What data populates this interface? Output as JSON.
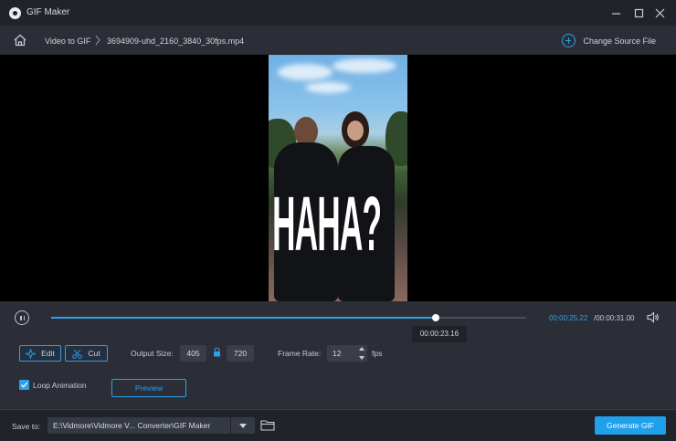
{
  "window": {
    "title": "GIF Maker",
    "minimize_icon": "minimize-icon",
    "maximize_icon": "maximize-icon",
    "close_icon": "close-icon"
  },
  "breadcrumb": {
    "home_icon": "home-icon",
    "items": [
      "Video to GIF",
      "3694909-uhd_2160_3840_30fps.mp4"
    ],
    "change_source_label": "Change Source File"
  },
  "video": {
    "overlay_text": "HAHA?"
  },
  "playback": {
    "current_time": "00:00:25.22",
    "total_time": "/00:00:31.00",
    "progress": 0.81,
    "hover_time": "00:00:23.16"
  },
  "options": {
    "edit_label": "Edit",
    "cut_label": "Cut",
    "output_size_label": "Output Size:",
    "width": "405",
    "height": "720",
    "frame_rate_label": "Frame Rate:",
    "frame_rate": "12",
    "fps_label": "fps",
    "loop_label": "Loop Animation",
    "loop_checked": true,
    "preview_label": "Preview"
  },
  "footer": {
    "save_to_label": "Save to:",
    "save_path": "E:\\Vidmore\\Vidmore V... Converter\\GIF Maker",
    "generate_label": "Generate GIF"
  },
  "colors": {
    "accent": "#2f9fe8",
    "background": "#2b2e36",
    "titlebar": "#20232a"
  }
}
